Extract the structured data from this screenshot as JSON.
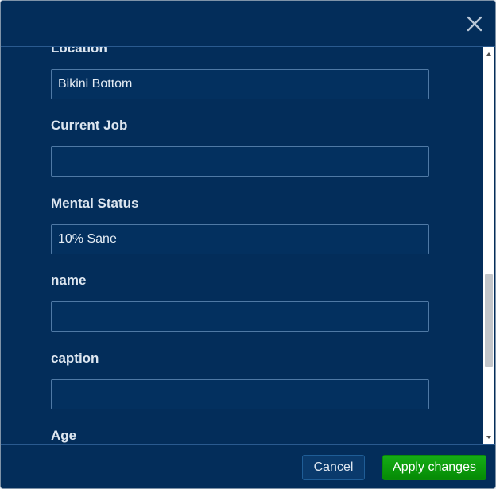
{
  "dialog": {
    "close_icon": "close-icon"
  },
  "fields": [
    {
      "label": "Location",
      "value": "Bikini Bottom",
      "placeholder": ""
    },
    {
      "label": "Current Job",
      "value": "",
      "placeholder": ""
    },
    {
      "label": "Mental Status",
      "value": "10% Sane",
      "placeholder": ""
    },
    {
      "label": "name",
      "value": "",
      "placeholder": ""
    },
    {
      "label": "caption",
      "value": "",
      "placeholder": ""
    },
    {
      "label": "Age",
      "value": "",
      "placeholder": ""
    }
  ],
  "footer": {
    "cancel_label": "Cancel",
    "apply_label": "Apply changes"
  },
  "colors": {
    "background": "#032d5a",
    "input_background": "#03305f",
    "apply_button": "#0b9a0b",
    "label_text": "#dde6f0"
  }
}
